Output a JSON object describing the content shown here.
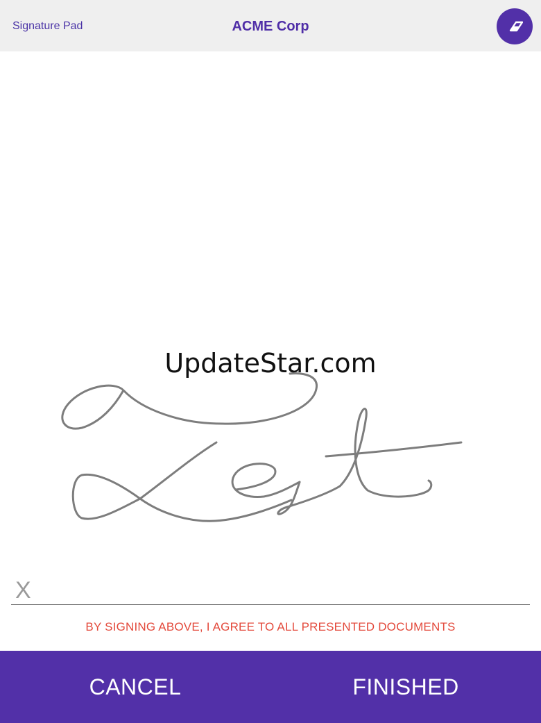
{
  "header": {
    "app_name": "Signature Pad",
    "title": "ACME Corp",
    "clear_icon": "eraser-icon"
  },
  "canvas": {
    "watermark": "UpdateStar.com",
    "signature_color": "#7d7d7d"
  },
  "signature_line": {
    "marker": "X"
  },
  "disclaimer": "BY SIGNING ABOVE, I AGREE TO ALL PRESENTED DOCUMENTS",
  "actions": {
    "cancel_label": "CANCEL",
    "finished_label": "FINISHED"
  },
  "colors": {
    "accent": "#5230a8",
    "disclaimer": "#e3493b",
    "header_bg": "#efefef"
  }
}
